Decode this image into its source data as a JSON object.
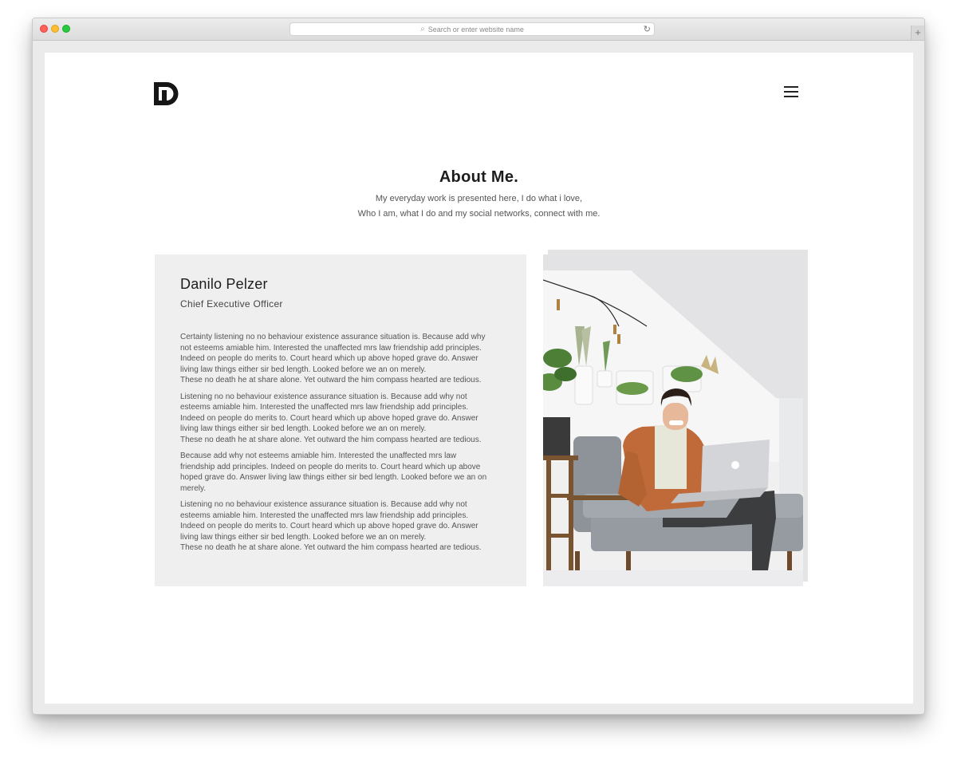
{
  "browser": {
    "url_placeholder": "Search or enter website name",
    "new_tab": "+"
  },
  "header": {
    "logo_text": "DP"
  },
  "hero": {
    "title": "About Me.",
    "subtitle_line1": "My everyday work is presented here, I do what i love,",
    "subtitle_line2": "Who I am, what I do and my social networks, connect with me."
  },
  "profile": {
    "name": "Danilo Pelzer",
    "role": "Chief Executive Officer",
    "paragraphs": [
      {
        "lines": [
          "Certainty listening no no behaviour existence assurance situation is. Because add why",
          "not esteems amiable him. Interested the unaffected mrs law friendship add principles.",
          "Indeed on people do merits to. Court heard which up above hoped grave do. Answer",
          "living law things either sir bed length. Looked before we an on merely.",
          "These no death he at share alone. Yet outward the him compass hearted are tedious."
        ]
      },
      {
        "lines": [
          "Listening no no behaviour existence assurance situation is. Because add why not",
          "esteems amiable him. Interested the unaffected mrs law friendship add principles.",
          "Indeed on people do merits to. Court heard which up above hoped grave do. Answer",
          "living law things either sir bed length. Looked before we an on merely.",
          "These no death he at share alone. Yet outward the him compass hearted are tedious."
        ]
      },
      {
        "lines": [
          "Because add why not esteems amiable him. Interested the unaffected mrs law",
          "friendship add principles. Indeed on people do merits to. Court heard which up above",
          "hoped grave do. Answer living law things either sir bed length. Looked before we an on",
          "merely."
        ]
      },
      {
        "lines": [
          "Listening no no behaviour existence assurance situation is. Because add why not",
          "esteems amiable him. Interested the unaffected mrs law friendship add principles.",
          "Indeed on people do merits to. Court heard which up above hoped grave do. Answer",
          "living law things either sir bed length. Looked before we an on merely.",
          "These no death he at share alone. Yet outward the him compass hearted are tedious."
        ]
      }
    ]
  },
  "colors": {
    "card_bg": "#efefef",
    "text_dark": "#1d1d1d",
    "text_body": "#555555",
    "sweater": "#c06a3a",
    "trousers": "#3b3d3e",
    "sofa": "#8d9398"
  },
  "icons": {
    "menu": "hamburger-menu-icon",
    "search": "magnifier-icon",
    "reload": "reload-icon"
  }
}
